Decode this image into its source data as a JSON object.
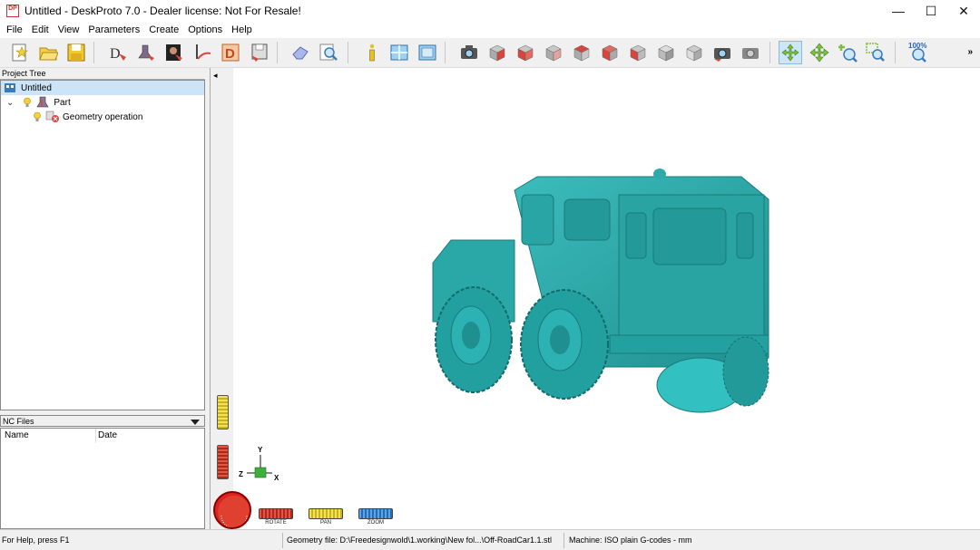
{
  "window": {
    "title": "Untitled - DeskProto 7.0 - Dealer license: Not For Resale!",
    "app_icon_text": "DP",
    "minimize_glyph": "—",
    "maximize_glyph": "☐",
    "close_glyph": "✕"
  },
  "menu": {
    "items": [
      "File",
      "Edit",
      "View",
      "Parameters",
      "Create",
      "Options",
      "Help"
    ]
  },
  "toolbar": {
    "zoom_level": "100%",
    "overflow_glyph": "»",
    "buttons": [
      "new-project-icon",
      "open-project-icon",
      "save-project-icon",
      "wizard-icon",
      "part-wizard-icon",
      "image-wizard-icon",
      "vector-wizard-icon",
      "d-icon",
      "save-as-icon",
      "eraser-icon",
      "preview-icon",
      "info-icon",
      "layout-icon",
      "screen-icon",
      "camera-icon",
      "front-view-icon",
      "back-view-icon",
      "left-view-icon",
      "right-view-icon",
      "top-view-icon",
      "bottom-view-icon",
      "iso-view-icon",
      "iso-view-2-icon",
      "camera-rotate-icon",
      "camera-reset-icon",
      "rotate-tool-icon",
      "pan-tool-icon",
      "zoom-tool-icon",
      "zoom-window-icon",
      "zoom-100-icon"
    ],
    "colors": {
      "red_face": "#d9453c",
      "grey_face": "#a9a9a9",
      "green_arrow": "#7ec03d",
      "blue_glass": "#62a7d8"
    }
  },
  "project_tree": {
    "header": "Project Tree",
    "root": "Untitled",
    "part": "Part",
    "child": "Geometry operation"
  },
  "nc_files": {
    "header": "NC Files",
    "columns": [
      "Name",
      "Date"
    ]
  },
  "viewport": {
    "arrow_glyph": "◂",
    "axes": {
      "y": "Y",
      "z": "Z",
      "x": "X"
    },
    "model_color": "#2eaaaa",
    "controls": {
      "rotate_label": "ROTATE",
      "pan_label": "PAN",
      "zoom_label": "ZOOM",
      "rotate_color": "#d23a2e",
      "pan_color": "#e8d43a",
      "zoom_color": "#3a8ad8"
    }
  },
  "status": {
    "help": "For Help, press F1",
    "geometry_file": "Geometry file: D:\\Freedesignwold\\1.working\\New fol...\\Off-RoadCar1.1.stl",
    "machine": "Machine: ISO plain G-codes - mm"
  }
}
